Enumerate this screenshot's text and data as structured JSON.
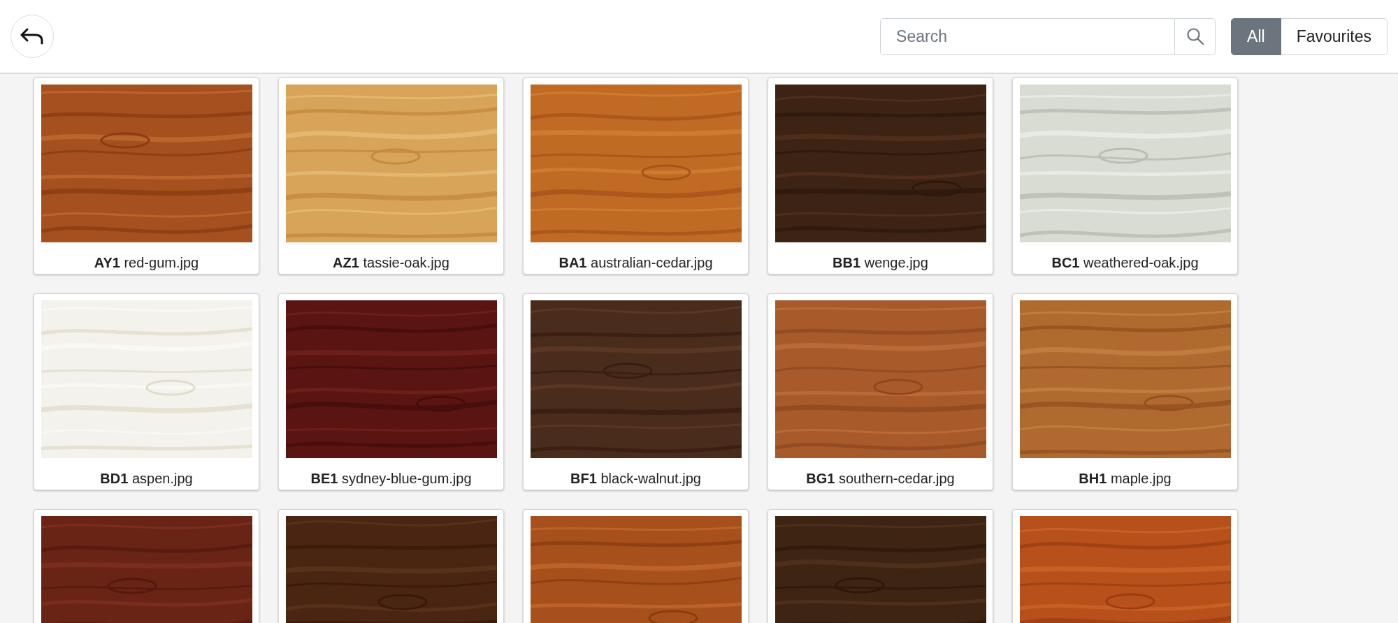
{
  "search": {
    "placeholder": "Search"
  },
  "filters": [
    {
      "label": "All",
      "selected": true
    },
    {
      "label": "Favourites",
      "selected": false
    }
  ],
  "tiles": [
    {
      "kind": "picture",
      "label": "**AY1** red-gum.jpg"
    },
    {
      "kind": "picture",
      "label": "**AZ1** tassie-oak.jpg"
    },
    {
      "kind": "picture",
      "label": "**BA1** australian-cedar.jpg"
    },
    {
      "kind": "picture",
      "label": "**BB1** wenge.jpg"
    },
    {
      "kind": "picture",
      "label": "**BC1** weathered-oak.jpg"
    },
    {
      "kind": "picture",
      "label": "**BD1** aspen.jpg"
    },
    {
      "kind": "picture",
      "label": "**BE1** sydney-blue-gum.jpg"
    },
    {
      "kind": "picture",
      "label": "**BF1** black-walnut.jpg"
    },
    {
      "kind": "picture",
      "label": "**BG1** southern-cedar.jpg"
    },
    {
      "kind": "picture",
      "label": "**BH1** maple.jpg"
    },
    {
      "kind": "picture"
    },
    {
      "kind": "picture"
    },
    {
      "kind": "picture"
    },
    {
      "kind": "picture"
    },
    {
      "kind": "picture"
    }
  ]
}
